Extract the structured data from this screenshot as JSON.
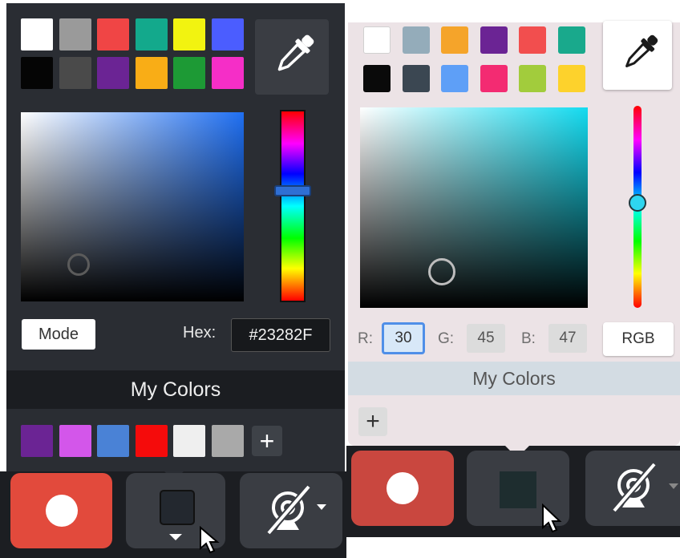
{
  "dark_picker": {
    "swatches": [
      "#ffffff",
      "#9a9a9a",
      "#f04545",
      "#13a98c",
      "#f2f310",
      "#4b5dff",
      "#050505",
      "#4a4a4a",
      "#6b2494",
      "#f9ad16",
      "#1d9a35",
      "#f52ec7"
    ],
    "mode_label": "Mode",
    "hex_label": "Hex:",
    "hex_value": "#23282F",
    "my_colors_title": "My Colors",
    "my_colors": [
      "#6b2494",
      "#d356ea",
      "#4a82d6",
      "#f50b0b",
      "#efefef",
      "#a9a9a9"
    ],
    "add_label": "+",
    "eyedropper_icon": "eyedropper-icon",
    "hue_level": 0.42,
    "current_color": "#23282F"
  },
  "light_picker": {
    "swatches": [
      "#ffffff",
      "#94acba",
      "#f5a42a",
      "#6b2494",
      "#f24e4e",
      "#19a98c",
      "#0a0a0a",
      "#3b4752",
      "#5e9ff7",
      "#f32b72",
      "#a2cc3c",
      "#fdd22c"
    ],
    "r_label": "R:",
    "r_value": "30",
    "g_label": "G:",
    "g_value": "45",
    "b_label": "B:",
    "b_value": "47",
    "rgb_button": "RGB",
    "my_colors_title": "My Colors",
    "add_label": "+",
    "eyedropper_icon": "eyedropper-icon",
    "hue_level": 0.48,
    "current_color": "#1e2d2f"
  },
  "toolbar_icons": [
    "record-icon",
    "color-swatch-icon",
    "webcam-off-icon",
    "chevron-down-icon",
    "cursor-icon"
  ]
}
